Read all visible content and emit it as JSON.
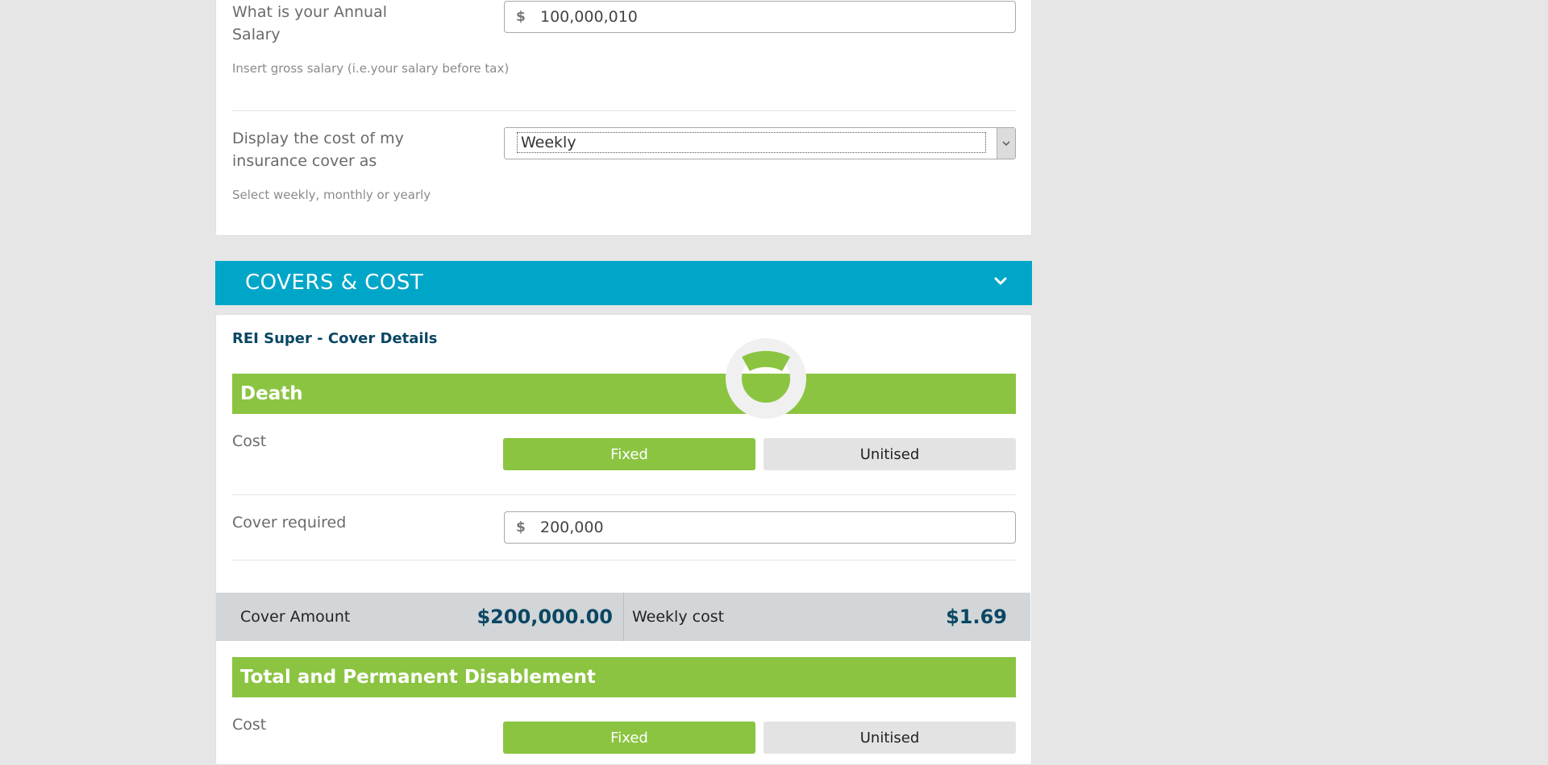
{
  "salary": {
    "label": "What is your Annual Salary",
    "hint": "Insert gross salary (i.e.your salary before tax)",
    "currency": "$",
    "value": "100,000,010"
  },
  "display_cost": {
    "label": "Display the cost of my insurance cover as",
    "hint": "Select weekly, monthly or yearly",
    "selected": "Weekly"
  },
  "section": {
    "title": "COVERS & COST"
  },
  "cover_details": {
    "title": "REI Super - Cover Details"
  },
  "death": {
    "heading": "Death",
    "cost_label": "Cost",
    "options": [
      "Fixed",
      "Unitised"
    ],
    "selected_option": "Fixed",
    "cover_required_label": "Cover required",
    "cover_required_currency": "$",
    "cover_required_value": "200,000",
    "summary": {
      "cover_amount_label": "Cover Amount",
      "cover_amount_value": "$200,000.00",
      "cost_label": "Weekly cost",
      "cost_value": "$1.69"
    }
  },
  "tpd": {
    "heading": "Total and Permanent Disablement",
    "cost_label": "Cost",
    "options": [
      "Fixed",
      "Unitised"
    ],
    "selected_option": "Fixed"
  },
  "colors": {
    "accent_teal": "#00a6c8",
    "accent_green": "#8bc441",
    "navy_text": "#0b4763",
    "summary_bg": "#d2d6d8"
  },
  "loading_spinner": {
    "visible": true
  }
}
